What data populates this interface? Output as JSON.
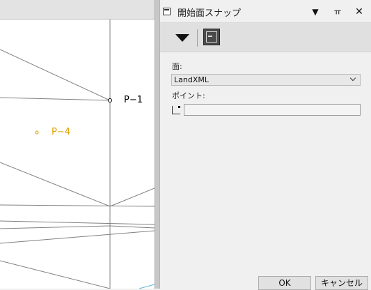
{
  "viewport": {
    "points": [
      {
        "label": "P−1",
        "color": "#000000"
      },
      {
        "label": "P−4",
        "color": "#e0a000"
      }
    ],
    "line_color": "#808080"
  },
  "panel": {
    "title": "開始面スナップ",
    "controls": {
      "dropdown_icon": "triangle-down-icon",
      "pin_icon": "pin-icon",
      "close_icon": "close-icon"
    },
    "toolbar": {
      "menu_icon": "caret-down-icon",
      "snap_icon": "window-icon"
    },
    "surface": {
      "label": "面:",
      "value": "LandXML"
    },
    "point": {
      "label": "ポイント:",
      "value": ""
    },
    "buttons": {
      "ok": "OK",
      "cancel": "キャンセル"
    }
  }
}
